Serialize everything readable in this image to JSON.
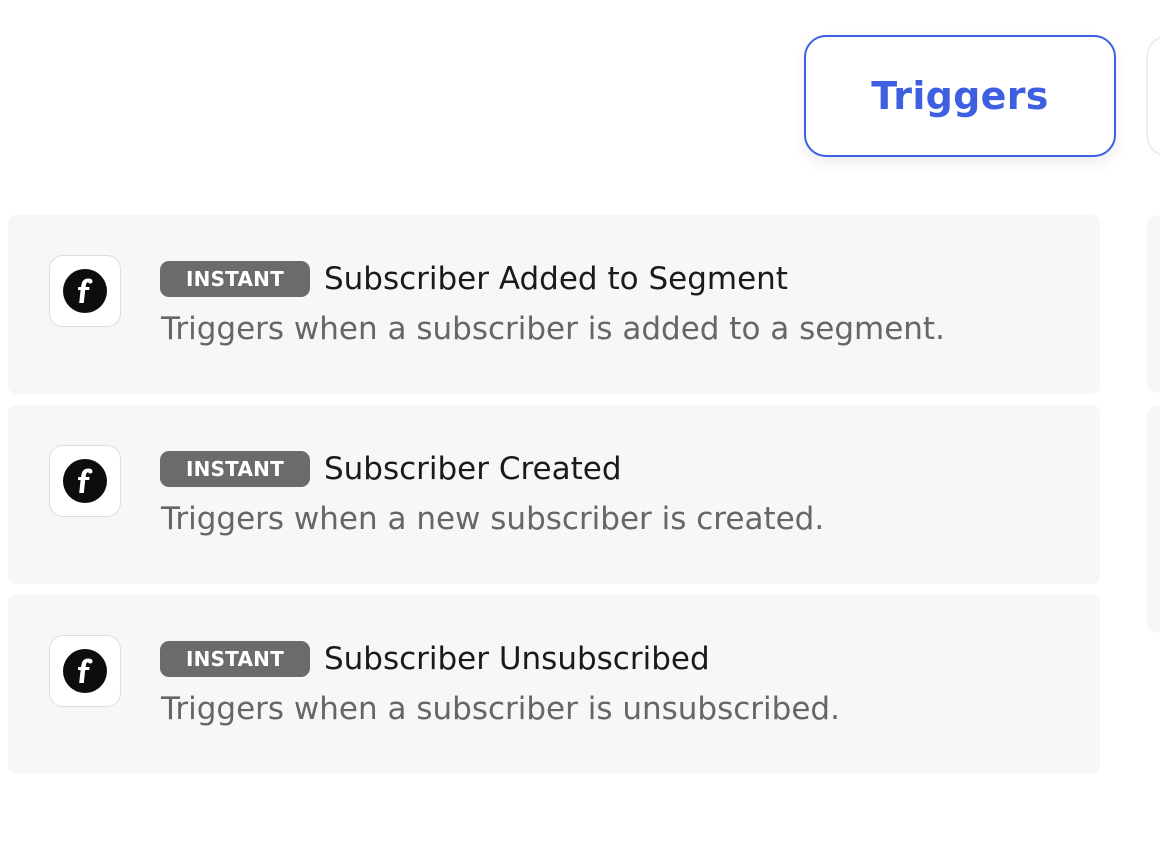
{
  "tabs": {
    "triggers_label": "Triggers"
  },
  "triggers": [
    {
      "badge": "INSTANT",
      "title": "Subscriber Added to Segment",
      "description": "Triggers when a subscriber is added to a segment.",
      "icon": "app-logo-icon"
    },
    {
      "badge": "INSTANT",
      "title": "Subscriber Created",
      "description": "Triggers when a new subscriber is created.",
      "icon": "app-logo-icon"
    },
    {
      "badge": "INSTANT",
      "title": "Subscriber Unsubscribed",
      "description": "Triggers when a subscriber is unsubscribed.",
      "icon": "app-logo-icon"
    }
  ],
  "colors": {
    "accent": "#3d5fe0",
    "badge": "#6b6b6b",
    "card_background": "#f7f7f7"
  }
}
